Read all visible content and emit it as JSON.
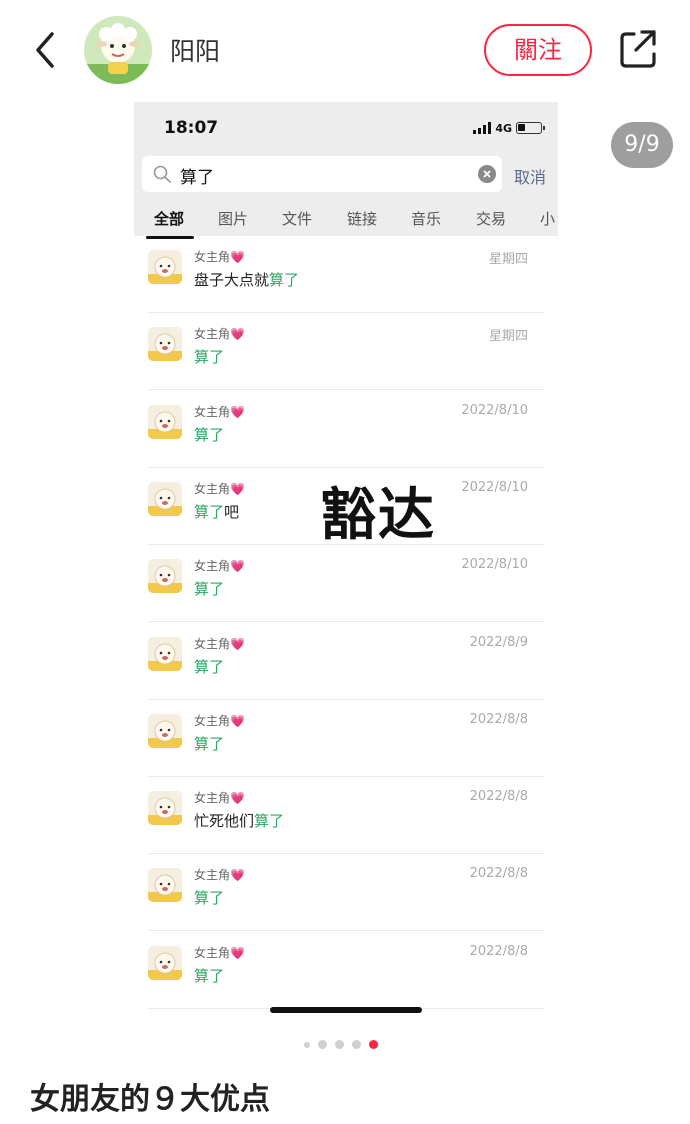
{
  "header": {
    "back_icon": "chevron-left-icon",
    "username": "阳阳",
    "follow_label": "關注",
    "share_icon": "share-external-icon",
    "accent_color": "#ff2442"
  },
  "image_counter": "9/9",
  "screenshot": {
    "status_bar": {
      "time": "18:07",
      "network": "4G"
    },
    "search": {
      "query": "算了",
      "cancel_label": "取消"
    },
    "tabs": [
      "全部",
      "图片",
      "文件",
      "链接",
      "音乐",
      "交易",
      "小"
    ],
    "active_tab": "全部",
    "results": [
      {
        "name": "女主角",
        "msg_prefix": "盘子大点就",
        "msg_highlight": "算了",
        "msg_suffix": "",
        "date": "星期四"
      },
      {
        "name": "女主角",
        "msg_prefix": "",
        "msg_highlight": "算了",
        "msg_suffix": "",
        "date": "星期四"
      },
      {
        "name": "女主角",
        "msg_prefix": "",
        "msg_highlight": "算了",
        "msg_suffix": "",
        "date": "2022/8/10"
      },
      {
        "name": "女主角",
        "msg_prefix": "",
        "msg_highlight": "算了",
        "msg_suffix": "吧",
        "date": "2022/8/10"
      },
      {
        "name": "女主角",
        "msg_prefix": "",
        "msg_highlight": "算了",
        "msg_suffix": "",
        "date": "2022/8/10"
      },
      {
        "name": "女主角",
        "msg_prefix": "",
        "msg_highlight": "算了",
        "msg_suffix": "",
        "date": "2022/8/9"
      },
      {
        "name": "女主角",
        "msg_prefix": "",
        "msg_highlight": "算了",
        "msg_suffix": "",
        "date": "2022/8/8"
      },
      {
        "name": "女主角",
        "msg_prefix": "忙死他们",
        "msg_highlight": "算了",
        "msg_suffix": "",
        "date": "2022/8/8"
      },
      {
        "name": "女主角",
        "msg_prefix": "",
        "msg_highlight": "算了",
        "msg_suffix": "",
        "date": "2022/8/8"
      },
      {
        "name": "女主角",
        "msg_prefix": "",
        "msg_highlight": "算了",
        "msg_suffix": "",
        "date": "2022/8/8"
      }
    ],
    "heart_glyph": "💗",
    "overlay_text": "豁达",
    "highlight_color": "#2aa866"
  },
  "pagination": {
    "total": 5,
    "active": 5
  },
  "post_title": "女朋友的９大优点"
}
